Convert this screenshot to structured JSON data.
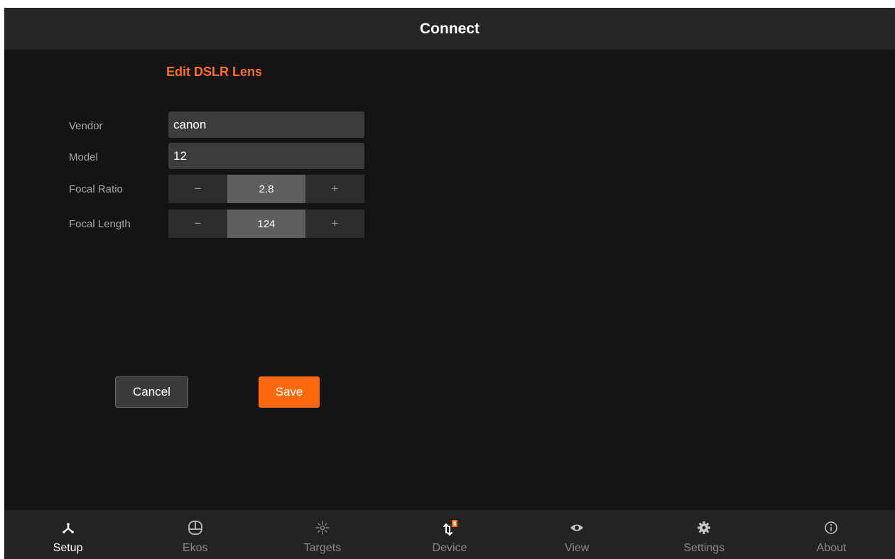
{
  "header": {
    "title": "Connect"
  },
  "form": {
    "title": "Edit DSLR Lens",
    "vendor": {
      "label": "Vendor",
      "value": "canon"
    },
    "model": {
      "label": "Model",
      "value": "12"
    },
    "focal_ratio": {
      "label": "Focal Ratio",
      "value": "2.8",
      "minus": "−",
      "plus": "+"
    },
    "focal_length": {
      "label": "Focal Length",
      "value": "124",
      "minus": "−",
      "plus": "+"
    }
  },
  "buttons": {
    "cancel": "Cancel",
    "save": "Save"
  },
  "nav": {
    "items": [
      {
        "label": "Setup",
        "icon": "setup-icon",
        "active": true
      },
      {
        "label": "Ekos",
        "icon": "ekos-icon",
        "active": false
      },
      {
        "label": "Targets",
        "icon": "targets-icon",
        "active": false
      },
      {
        "label": "Device",
        "icon": "device-icon",
        "active": false
      },
      {
        "label": "View",
        "icon": "eye-icon",
        "active": false
      },
      {
        "label": "Settings",
        "icon": "gear-icon",
        "active": false
      },
      {
        "label": "About",
        "icon": "info-icon",
        "active": false
      }
    ]
  },
  "colors": {
    "accent": "#ff6a10",
    "title_accent": "#ff6d1f",
    "background": "#141414",
    "bar": "#262626"
  }
}
